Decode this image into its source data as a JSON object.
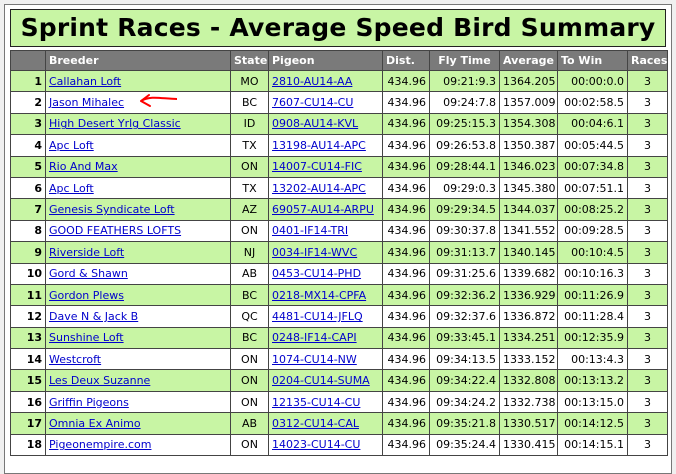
{
  "title": "Sprint Races - Average Speed Bird Summary",
  "columns": [
    "",
    "Breeder",
    "State",
    "Pigeon",
    "Dist.",
    "Fly Time",
    "Average",
    "To Win",
    "Races"
  ],
  "rows": [
    {
      "rank": "1",
      "breeder": "Callahan Loft",
      "state": "MO",
      "pigeon": "2810-AU14-AA",
      "dist": "434.96",
      "fly_time": "09:21:9.3",
      "average": "1364.205",
      "to_win": "00:00:0.0",
      "races": "3"
    },
    {
      "rank": "2",
      "breeder": "Jason Mihalec",
      "state": "BC",
      "pigeon": "7607-CU14-CU",
      "dist": "434.96",
      "fly_time": "09:24:7.8",
      "average": "1357.009",
      "to_win": "00:02:58.5",
      "races": "3"
    },
    {
      "rank": "3",
      "breeder": "High Desert Yrlg Classic",
      "state": "ID",
      "pigeon": "0908-AU14-KVL",
      "dist": "434.96",
      "fly_time": "09:25:15.3",
      "average": "1354.308",
      "to_win": "00:04:6.1",
      "races": "3"
    },
    {
      "rank": "4",
      "breeder": "Apc Loft",
      "state": "TX",
      "pigeon": "13198-AU14-APC",
      "dist": "434.96",
      "fly_time": "09:26:53.8",
      "average": "1350.387",
      "to_win": "00:05:44.5",
      "races": "3"
    },
    {
      "rank": "5",
      "breeder": "Rio And Max",
      "state": "ON",
      "pigeon": "14007-CU14-FIC",
      "dist": "434.96",
      "fly_time": "09:28:44.1",
      "average": "1346.023",
      "to_win": "00:07:34.8",
      "races": "3"
    },
    {
      "rank": "6",
      "breeder": "Apc Loft",
      "state": "TX",
      "pigeon": "13202-AU14-APC",
      "dist": "434.96",
      "fly_time": "09:29:0.3",
      "average": "1345.380",
      "to_win": "00:07:51.1",
      "races": "3"
    },
    {
      "rank": "7",
      "breeder": "Genesis Syndicate Loft",
      "state": "AZ",
      "pigeon": "69057-AU14-ARPU",
      "dist": "434.96",
      "fly_time": "09:29:34.5",
      "average": "1344.037",
      "to_win": "00:08:25.2",
      "races": "3"
    },
    {
      "rank": "8",
      "breeder": "GOOD FEATHERS LOFTS",
      "state": "ON",
      "pigeon": "0401-IF14-TRI",
      "dist": "434.96",
      "fly_time": "09:30:37.8",
      "average": "1341.552",
      "to_win": "00:09:28.5",
      "races": "3"
    },
    {
      "rank": "9",
      "breeder": "Riverside Loft",
      "state": "NJ",
      "pigeon": "0034-IF14-WVC",
      "dist": "434.96",
      "fly_time": "09:31:13.7",
      "average": "1340.145",
      "to_win": "00:10:4.5",
      "races": "3"
    },
    {
      "rank": "10",
      "breeder": "Gord & Shawn",
      "state": "AB",
      "pigeon": "0453-CU14-PHD",
      "dist": "434.96",
      "fly_time": "09:31:25.6",
      "average": "1339.682",
      "to_win": "00:10:16.3",
      "races": "3"
    },
    {
      "rank": "11",
      "breeder": "Gordon Plews",
      "state": "BC",
      "pigeon": "0218-MX14-CPFA",
      "dist": "434.96",
      "fly_time": "09:32:36.2",
      "average": "1336.929",
      "to_win": "00:11:26.9",
      "races": "3"
    },
    {
      "rank": "12",
      "breeder": "Dave N & Jack B",
      "state": "QC",
      "pigeon": "4481-CU14-JFLQ",
      "dist": "434.96",
      "fly_time": "09:32:37.6",
      "average": "1336.872",
      "to_win": "00:11:28.4",
      "races": "3"
    },
    {
      "rank": "13",
      "breeder": "Sunshine Loft",
      "state": "BC",
      "pigeon": "0248-IF14-CAPI",
      "dist": "434.96",
      "fly_time": "09:33:45.1",
      "average": "1334.251",
      "to_win": "00:12:35.9",
      "races": "3"
    },
    {
      "rank": "14",
      "breeder": "Westcroft",
      "state": "ON",
      "pigeon": "1074-CU14-NW",
      "dist": "434.96",
      "fly_time": "09:34:13.5",
      "average": "1333.152",
      "to_win": "00:13:4.3",
      "races": "3"
    },
    {
      "rank": "15",
      "breeder": "Les Deux Suzanne",
      "state": "ON",
      "pigeon": "0204-CU14-SUMA",
      "dist": "434.96",
      "fly_time": "09:34:22.4",
      "average": "1332.808",
      "to_win": "00:13:13.2",
      "races": "3"
    },
    {
      "rank": "16",
      "breeder": "Griffin Pigeons",
      "state": "ON",
      "pigeon": "12135-CU14-CU",
      "dist": "434.96",
      "fly_time": "09:34:24.2",
      "average": "1332.738",
      "to_win": "00:13:15.0",
      "races": "3"
    },
    {
      "rank": "17",
      "breeder": "Omnia Ex Animo",
      "state": "AB",
      "pigeon": "0312-CU14-CAL",
      "dist": "434.96",
      "fly_time": "09:35:21.8",
      "average": "1330.517",
      "to_win": "00:14:12.5",
      "races": "3"
    },
    {
      "rank": "18",
      "breeder": "Pigeonempire.com",
      "state": "ON",
      "pigeon": "14023-CU14-CU",
      "dist": "434.96",
      "fly_time": "09:35:24.4",
      "average": "1330.415",
      "to_win": "00:14:15.1",
      "races": "3"
    }
  ],
  "colors": {
    "title_bg": "#c8f5a4",
    "header_bg": "#7a7a7a",
    "alt_row_bg": "#c8f5a4",
    "link": "#0000cc",
    "annotation_arrow": "#ff0000"
  },
  "annotation": {
    "icon": "red-arrow-icon"
  }
}
